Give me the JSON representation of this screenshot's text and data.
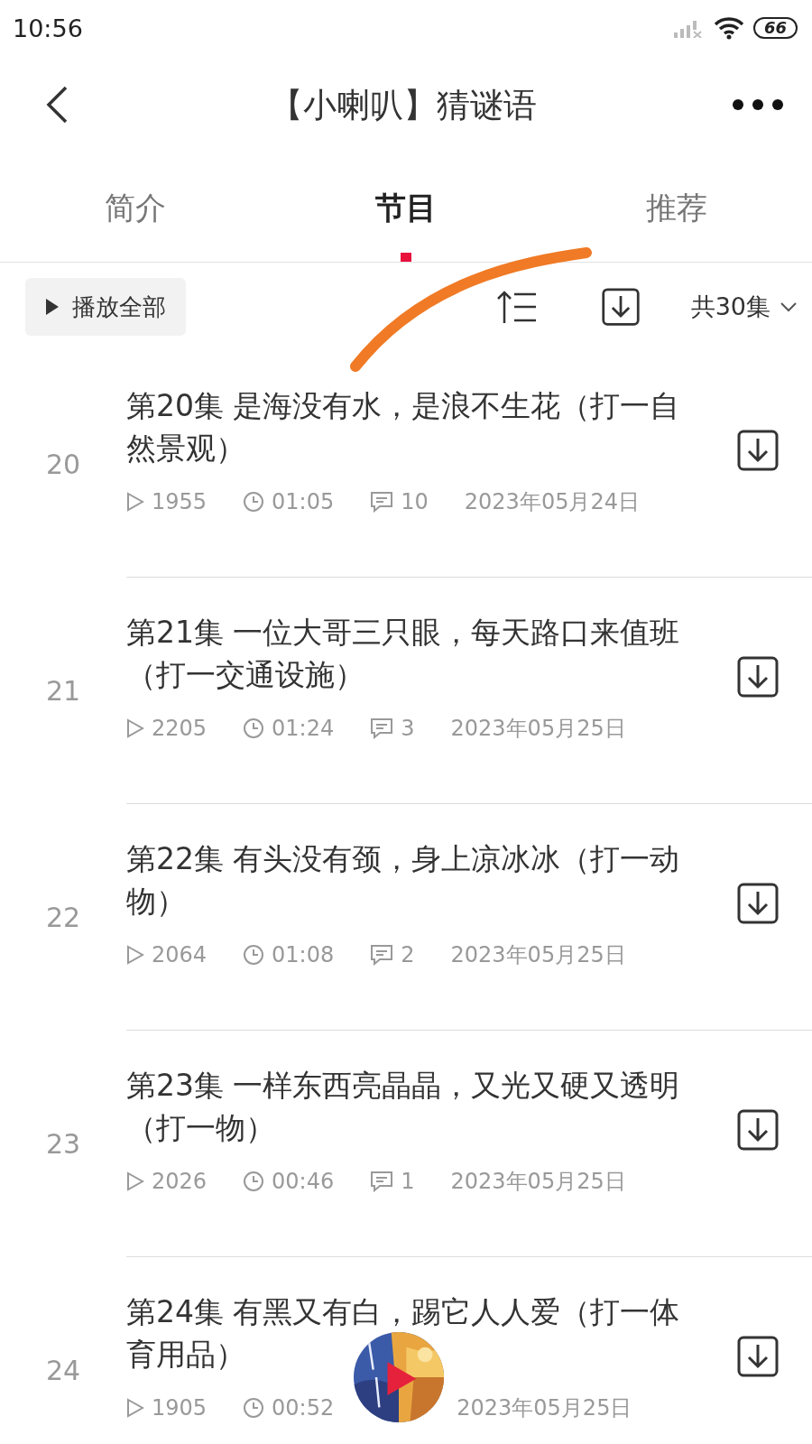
{
  "status_bar": {
    "time": "10:56",
    "battery": "66"
  },
  "header": {
    "title": "【小喇叭】猜谜语"
  },
  "tabs": [
    {
      "label": "简介",
      "selected": false
    },
    {
      "label": "节目",
      "selected": true
    },
    {
      "label": "推荐",
      "selected": false
    }
  ],
  "toolbar": {
    "play_all": "播放全部",
    "episode_count": "共30集"
  },
  "episodes": [
    {
      "number": "20",
      "title": "第20集 是海没有水，是浪不生花（打一自然景观）",
      "plays": "1955",
      "duration": "01:05",
      "comments": "10",
      "date": "2023年05月24日"
    },
    {
      "number": "21",
      "title": "第21集 一位大哥三只眼，每天路口来值班（打一交通设施）",
      "plays": "2205",
      "duration": "01:24",
      "comments": "3",
      "date": "2023年05月25日"
    },
    {
      "number": "22",
      "title": "第22集 有头没有颈，身上凉冰冰（打一动物）",
      "plays": "2064",
      "duration": "01:08",
      "comments": "2",
      "date": "2023年05月25日"
    },
    {
      "number": "23",
      "title": "第23集 一样东西亮晶晶，又光又硬又透明（打一物）",
      "plays": "2026",
      "duration": "00:46",
      "comments": "1",
      "date": "2023年05月25日"
    },
    {
      "number": "24",
      "title": "第24集 有黑又有白，踢它人人爱（打一体育用品）",
      "plays": "1905",
      "duration": "00:52",
      "date": "2023年05月25日"
    }
  ]
}
